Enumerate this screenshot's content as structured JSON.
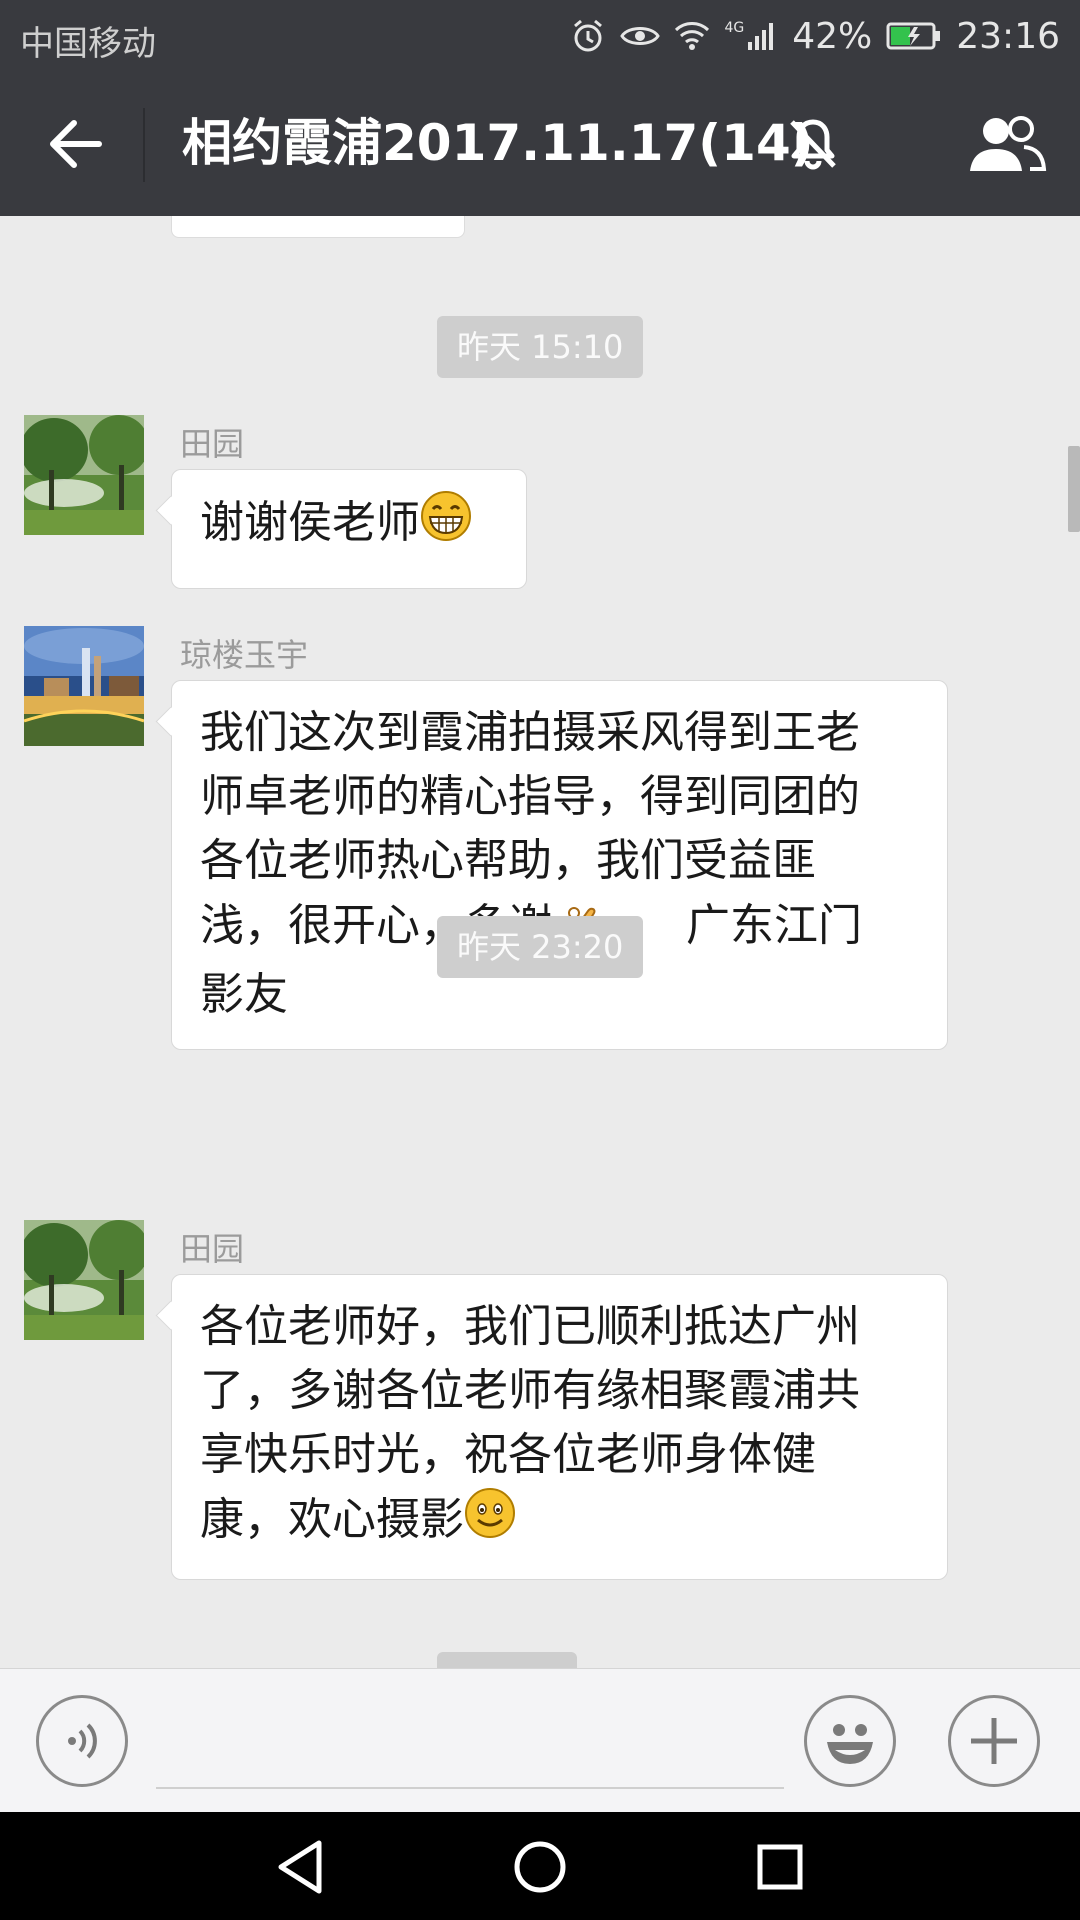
{
  "status_bar": {
    "carrier": "中国移动",
    "network": "4G",
    "battery": "42%",
    "time": "23:16",
    "icons": [
      "alarm-icon",
      "eye-icon",
      "wifi-icon",
      "signal-icon",
      "battery-charging-icon"
    ]
  },
  "header": {
    "title": "相约霞浦2017.11.17(14)",
    "icons": [
      "back-arrow-icon",
      "mute-bell-icon",
      "group-members-icon"
    ]
  },
  "chat": {
    "timestamps": [
      "昨天 15:10",
      "昨天 23:20"
    ],
    "messages": [
      {
        "sender": "田园",
        "avatar": "park-avatar",
        "lines": [
          "谢谢侯老师"
        ],
        "emoji": "grin-emoji"
      },
      {
        "sender": "琼楼玉宇",
        "avatar": "city-avatar",
        "lines": [
          "我们这次到霞浦拍摄采风得到王老",
          "师卓老师的精心指导，得到同团的",
          "各位老师热心帮助，我们受益匪",
          "浅，很开心，多谢",
          "影友"
        ],
        "inline_trailing": "广东江门",
        "emoji": "ok-hand-emoji"
      },
      {
        "sender": "田园",
        "avatar": "park-avatar",
        "lines": [
          "各位老师好，我们已顺利抵达广州",
          "了，多谢各位老师有缘相聚霞浦共",
          "享快乐时光，祝各位老师身体健",
          "康，欢心摄影"
        ],
        "emoji": "smile-emoji"
      }
    ]
  },
  "input_bar": {
    "value": "",
    "icons": [
      "voice-icon",
      "emoji-icon",
      "plus-icon"
    ]
  },
  "nav_bar": {
    "icons": [
      "nav-back-icon",
      "nav-home-icon",
      "nav-recents-icon"
    ]
  },
  "colors": {
    "header_bg": "#393a3f",
    "chat_bg": "#ebebeb",
    "bubble_bg": "#ffffff",
    "timestamp_bg": "#cecece"
  }
}
